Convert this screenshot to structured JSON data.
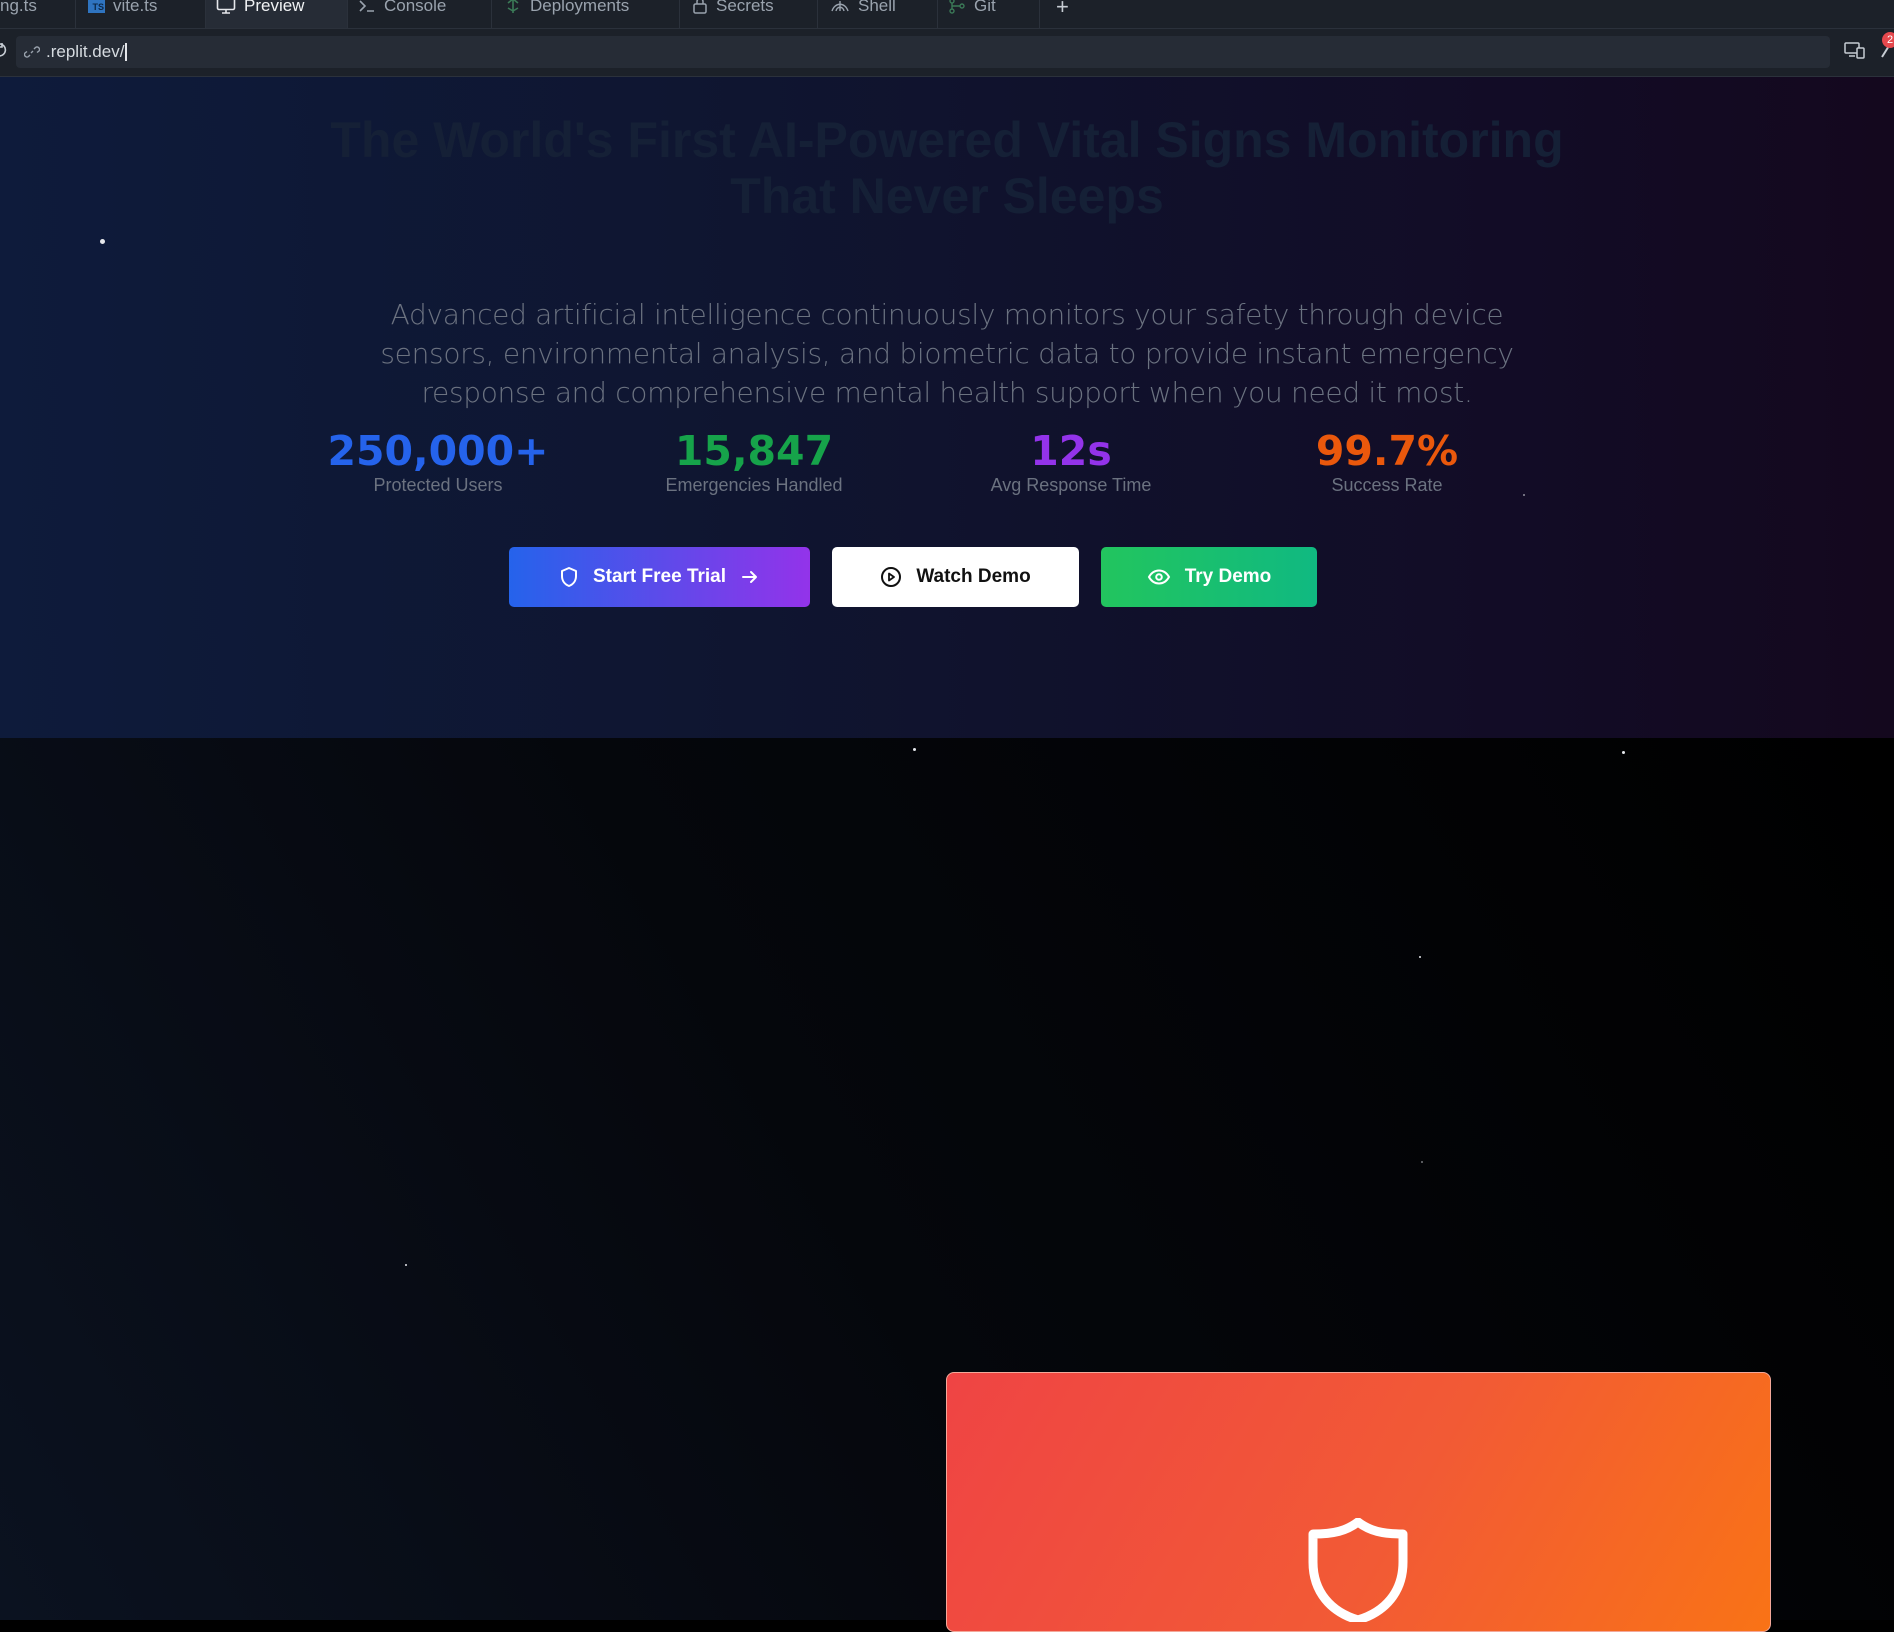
{
  "tabs": [
    {
      "label": "ng.ts",
      "icon": "typescript-file-icon"
    },
    {
      "label": "vite.ts",
      "icon": "typescript-file-icon"
    },
    {
      "label": "Preview",
      "icon": "monitor-icon",
      "active": true
    },
    {
      "label": "Console",
      "icon": "terminal-icon"
    },
    {
      "label": "Deployments",
      "icon": "deployments-icon"
    },
    {
      "label": "Secrets",
      "icon": "lock-icon"
    },
    {
      "label": "Shell",
      "icon": "shell-icon"
    },
    {
      "label": "Git",
      "icon": "git-branch-icon"
    }
  ],
  "new_tab_label": "+",
  "address_bar": {
    "url": ".replit.dev/"
  },
  "notification_count": "2",
  "hero": {
    "title_line1": "The World's First AI-Powered Vital Signs Monitoring",
    "title_line2": "That Never Sleeps",
    "subtitle": "Advanced artificial intelligence continuously monitors your safety through device sensors, environmental analysis, and biometric data to provide instant emergency response and comprehensive mental health support when you need it most.",
    "stats": [
      {
        "value": "250,000+",
        "label": "Protected Users",
        "color": "#2563eb"
      },
      {
        "value": "15,847",
        "label": "Emergencies Handled",
        "color": "#16a34a"
      },
      {
        "value": "12s",
        "label": "Avg Response Time",
        "color": "#9333ea"
      },
      {
        "value": "99.7%",
        "label": "Success Rate",
        "color": "#ea580c"
      }
    ],
    "buttons": {
      "start_trial": "Start Free Trial",
      "watch_demo": "Watch Demo",
      "try_demo": "Try Demo"
    }
  },
  "colors": {
    "primary_gradient_start": "#2563eb",
    "primary_gradient_end": "#9333ea",
    "green": "#22c55e",
    "card_gradient_start": "#ef4444",
    "card_gradient_end": "#f97316"
  }
}
